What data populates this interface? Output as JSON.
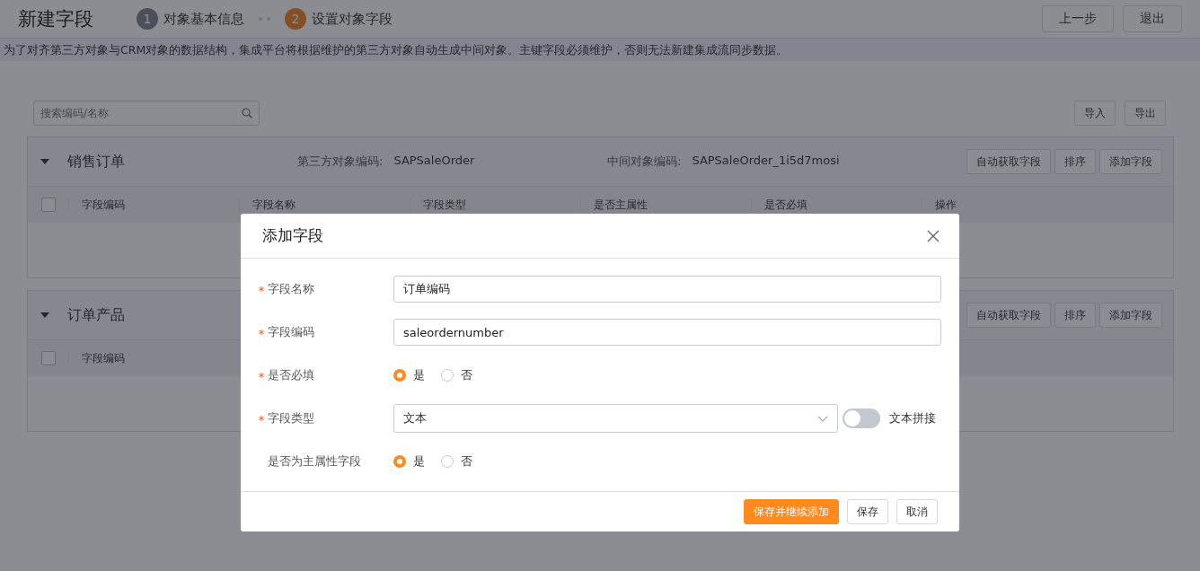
{
  "header": {
    "title": "新建字段",
    "steps": [
      {
        "number": "1",
        "label": "对象基本信息",
        "selected": false
      },
      {
        "number": "2",
        "label": "设置对象字段",
        "selected": true
      }
    ],
    "buttons": [
      "上一步",
      "退出"
    ]
  },
  "notice": "为了对齐第三方对象与CRM对象的数据结构，集成平台将根据维护的第三方对象自动生成中间对象。主键字段必须维护，否则无法新建集成流同步数据。",
  "toolbar": {
    "search_placeholder": "搜索编码/名称",
    "buttons": [
      "导入",
      "导出"
    ]
  },
  "sections": [
    {
      "title": "销售订单",
      "expanded": true,
      "info": [
        {
          "label": "第三方对象编码:",
          "value": "SAPSaleOrder"
        },
        {
          "label": "中间对象编码:",
          "value": "SAPSaleOrder_1i5d7mosi"
        }
      ],
      "buttons": [
        "自动获取字段",
        "排序",
        "添加字段"
      ],
      "checked": false,
      "columns": [
        "字段编码",
        "字段名称",
        "字段类型",
        "是否主属性",
        "是否必填",
        "操作"
      ]
    },
    {
      "title": "订单产品",
      "expanded": true,
      "buttons": [
        "自动获取字段",
        "排序",
        "添加字段"
      ],
      "checked": false,
      "columns": [
        "字段编码"
      ]
    }
  ],
  "dialog": {
    "title": "添加字段",
    "rows": [
      {
        "kind": "input",
        "label": "字段名称",
        "required": true,
        "value": "订单编码"
      },
      {
        "kind": "input",
        "label": "字段编码",
        "required": true,
        "value": "saleordernumber"
      },
      {
        "kind": "radio",
        "label": "是否必填",
        "required": true,
        "options": [
          {
            "label": "是",
            "selected": true
          },
          {
            "label": "否",
            "selected": false
          }
        ]
      },
      {
        "kind": "select",
        "label": "字段类型",
        "required": true,
        "value": "文本",
        "toggle": {
          "label": "文本拼接",
          "on": false
        }
      },
      {
        "kind": "radio",
        "label": "是否为主属性字段",
        "required": false,
        "options": [
          {
            "label": "是",
            "selected": true
          },
          {
            "label": "否",
            "selected": false
          }
        ]
      }
    ],
    "buttons": [
      {
        "label": "保存并继续添加",
        "primary": true
      },
      {
        "label": "保存",
        "primary": false
      },
      {
        "label": "取消",
        "primary": false
      }
    ]
  }
}
